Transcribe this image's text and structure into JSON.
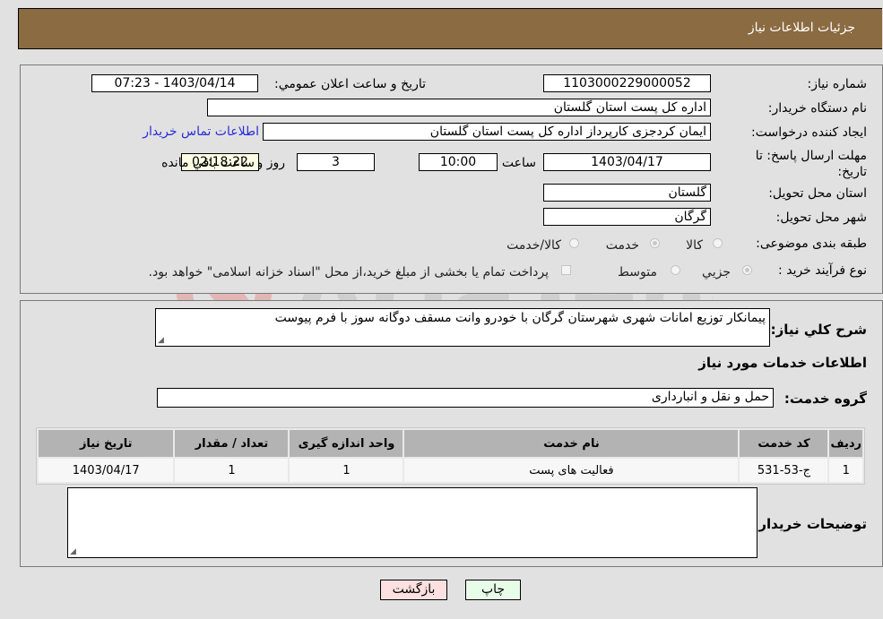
{
  "header": {
    "title": "جزئیات اطلاعات نیاز"
  },
  "details": {
    "need_number_label": "شماره نیاز:",
    "need_number": "1103000229000052",
    "announce_label": "تاریخ و ساعت اعلان عمومي:",
    "announce_value": "1403/04/14 - 07:23",
    "buyer_org_label": "نام دستگاه خریدار:",
    "buyer_org": "اداره کل پست استان گلستان",
    "creator_label": "ایجاد کننده درخواست:",
    "creator": "ایمان کردجزی کارپرداز اداره کل پست استان گلستان",
    "contact_link": "اطلاعات تماس خریدار",
    "deadline_label": "مهلت ارسال پاسخ: تا تاریخ:",
    "deadline_date": "1403/04/17",
    "time_label": "ساعت",
    "deadline_time": "10:00",
    "days_value": "3",
    "days_label": "روز و",
    "remaining_time": "02:18:22",
    "remaining_label": "ساعت باقي مانده",
    "province_label": "استان محل تحویل:",
    "province": "گلستان",
    "city_label": "شهر محل تحویل:",
    "city": "گرگان",
    "category_label": "طبقه بندی موضوعی:",
    "category_options": [
      {
        "label": "کالا",
        "selected": false
      },
      {
        "label": "خدمت",
        "selected": true
      },
      {
        "label": "کالا/خدمت",
        "selected": false
      }
    ],
    "process_label": "نوع فرآیند خرید :",
    "process_options": [
      {
        "label": "جزيي",
        "selected": true
      },
      {
        "label": "متوسط",
        "selected": false
      }
    ],
    "treasury_note": "پرداخت تمام یا بخشی از مبلغ خرید،از محل \"اسناد خزانه اسلامی\" خواهد بود."
  },
  "description": {
    "label": "شرح کلي نیاز:",
    "value": "پیمانکار توزیع امانات شهری شهرستان گرگان با خودرو وانت مسقف دوگانه سوز با فرم پیوست"
  },
  "services": {
    "section_title": "اطلاعات خدمات مورد نیاز",
    "group_label": "گروه خدمت:",
    "group_value": "حمل و نقل و انبارداری",
    "columns": [
      "ردیف",
      "کد خدمت",
      "نام خدمت",
      "واحد اندازه گیری",
      "تعداد / مقدار",
      "تاریخ نیاز"
    ],
    "rows": [
      [
        "1",
        "ج-53-531",
        "فعالیت های پست",
        "1",
        "1",
        "1403/04/17"
      ]
    ]
  },
  "buyer_notes": {
    "label": "توضیحات خریدار:",
    "value": ""
  },
  "buttons": {
    "print": "چاپ",
    "back": "بازگشت"
  },
  "colors": {
    "header": "#8b6b41",
    "link": "#2a2ad8",
    "print_bg": "#e8fde8",
    "back_bg": "#fde0e0"
  }
}
